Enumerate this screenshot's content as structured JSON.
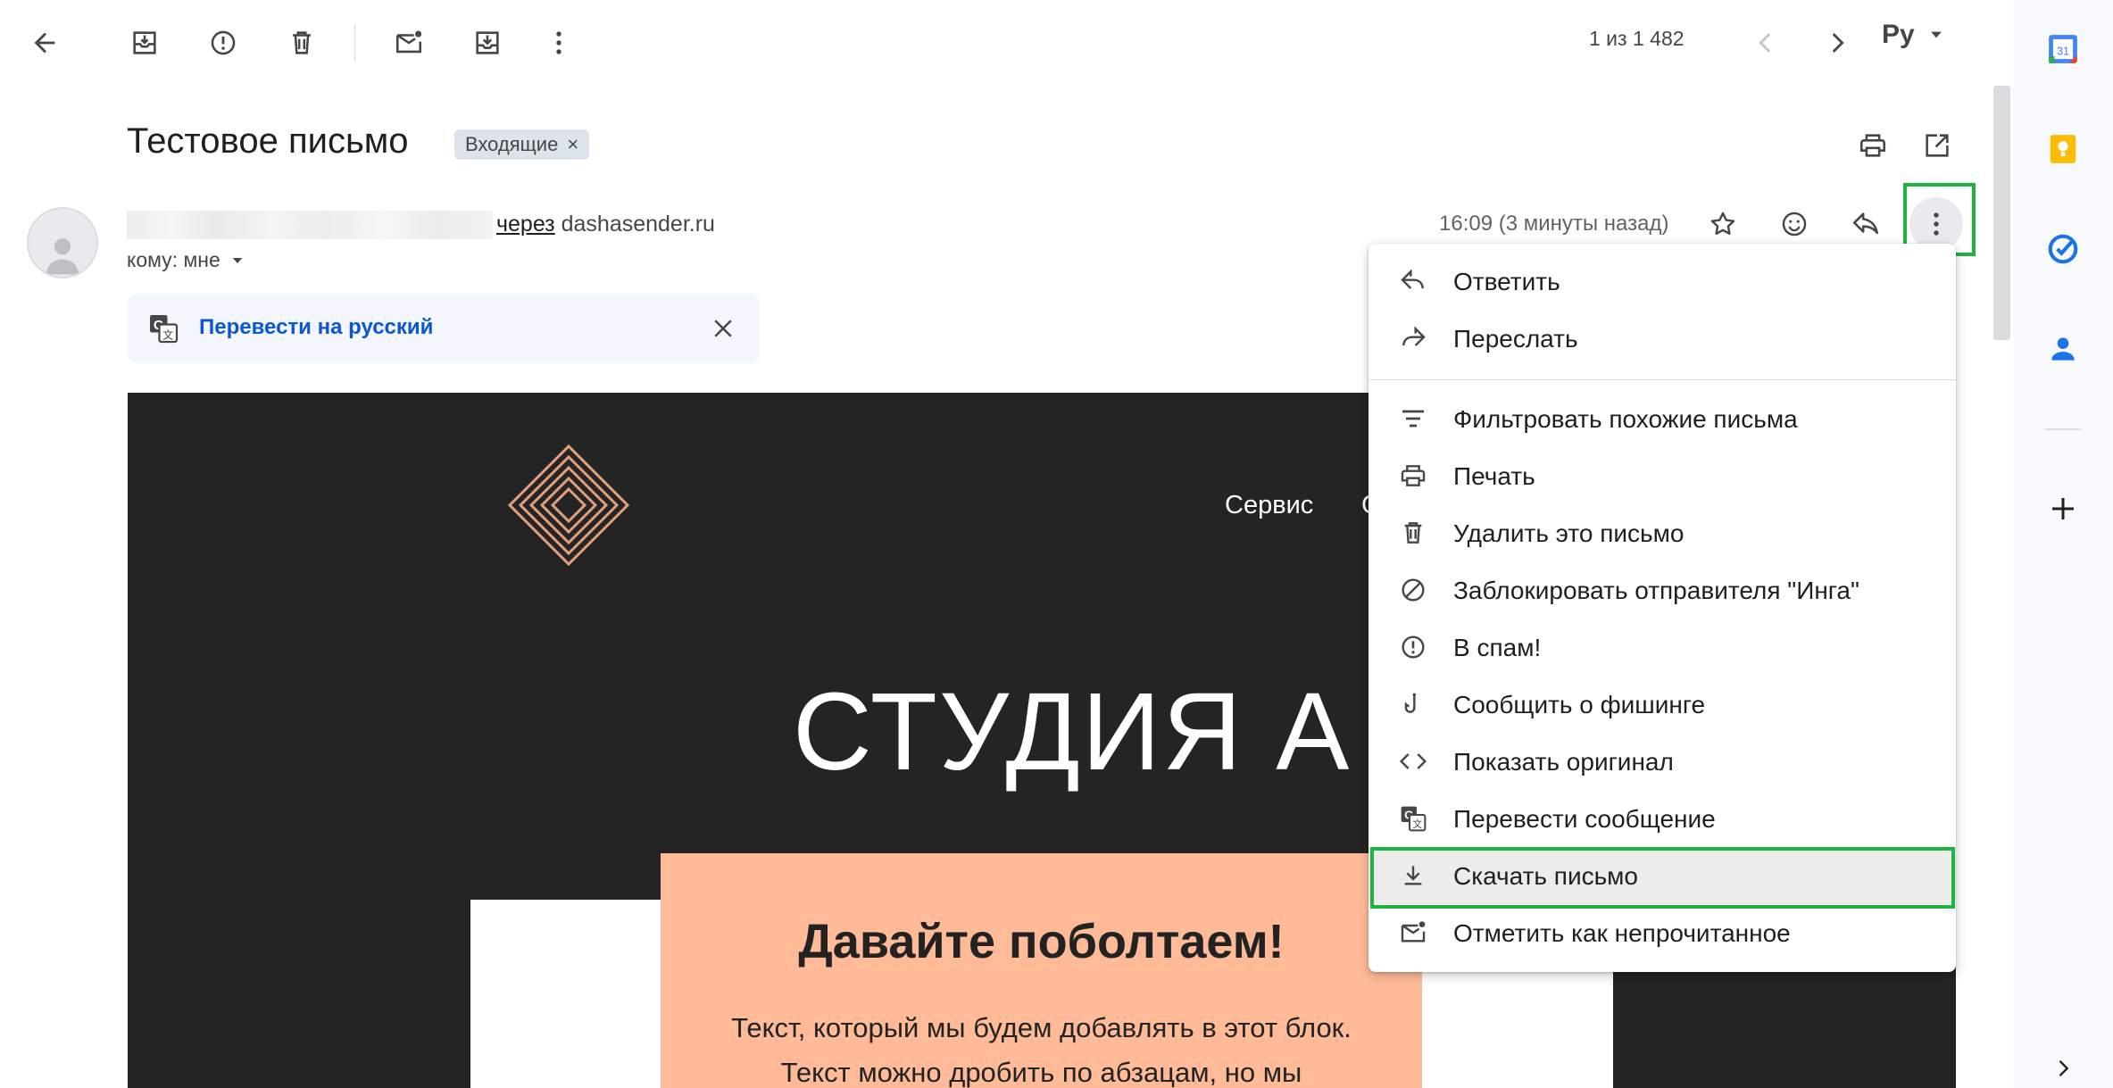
{
  "toolbar": {
    "pager": "1 из 1 482",
    "lang": "Ру"
  },
  "email": {
    "subject": "Тестовое письмо",
    "label": "Входящие",
    "via_word": "через",
    "via_domain": "dashasender.ru",
    "to": "кому: мне",
    "time": "16:09 (3 минуты назад)",
    "translate_link": "Перевести на русский"
  },
  "body": {
    "nav_item": "Сервис",
    "nav_item_partial": "С",
    "heading": "СТУДИЯ А",
    "block_title": "Давайте поболтаем!",
    "block_line1": "Текст, который мы будем добавлять в этот  блок.",
    "block_line2": "Текст можно дробить по абзацам, но мы"
  },
  "menu": {
    "items": [
      {
        "label": "Ответить",
        "icon": "reply-icon"
      },
      {
        "label": "Переслать",
        "icon": "forward-icon"
      },
      {
        "label": "Фильтровать похожие письма",
        "icon": "filter-icon"
      },
      {
        "label": "Печать",
        "icon": "print-icon"
      },
      {
        "label": "Удалить это письмо",
        "icon": "trash-icon"
      },
      {
        "label": "Заблокировать отправителя \"Инга\"",
        "icon": "block-icon"
      },
      {
        "label": "В спам!",
        "icon": "spam-icon"
      },
      {
        "label": "Сообщить о фишинге",
        "icon": "phishing-hook-icon"
      },
      {
        "label": "Показать оригинал",
        "icon": "code-icon"
      },
      {
        "label": "Перевести сообщение",
        "icon": "translate-icon"
      },
      {
        "label": "Скачать письмо",
        "icon": "download-icon"
      },
      {
        "label": "Отметить как непрочитанное",
        "icon": "mark-unread-icon"
      }
    ]
  },
  "side_panel": {
    "calendar_day": "31"
  },
  "colors": {
    "highlight": "#1db43f",
    "email_bg": "#242424",
    "peach": "#ffbb98",
    "logo": "#e0a07e",
    "link": "#0b57d0"
  }
}
